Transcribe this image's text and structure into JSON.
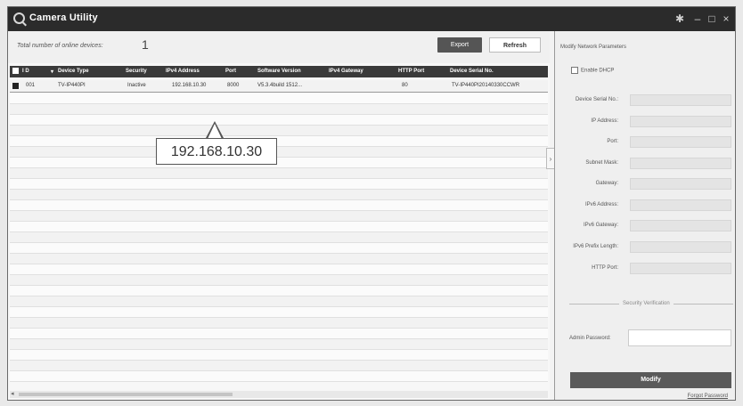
{
  "window": {
    "title": "Camera Utility",
    "controls": {
      "settings": "✱",
      "minimize": "–",
      "maximize": "□",
      "close": "×"
    }
  },
  "toolbar": {
    "count_label": "Total number of online devices:",
    "count_value": "1",
    "export_label": "Export",
    "refresh_label": "Refresh"
  },
  "table": {
    "columns": [
      "I D",
      "Device Type",
      "Security",
      "IPv4 Address",
      "Port",
      "Software Version",
      "IPv4 Gateway",
      "HTTP Port",
      "Device Serial No."
    ],
    "rows": [
      [
        "001",
        "TV-IP440PI",
        "Inactive",
        "192.168.10.30",
        "8000",
        "V5.3.4build 1512...",
        "",
        "80",
        "TV-IP440PI20140330CCWR"
      ]
    ]
  },
  "callout": {
    "text": "192.168.10.30"
  },
  "panel": {
    "header": "Modify Network Parameters",
    "dhcp_label": "Enable DHCP",
    "fields": [
      "Device Serial No.:",
      "IP Address:",
      "Port:",
      "Subnet Mask:",
      "Gateway:",
      "IPv6 Address:",
      "IPv6 Gateway:",
      "IPv6 Prefix Length:",
      "HTTP Port:"
    ],
    "security_label": "Security Verification",
    "admin_password_label": "Admin Password:",
    "modify_label": "Modify",
    "forgot_label": "Forgot Password"
  }
}
